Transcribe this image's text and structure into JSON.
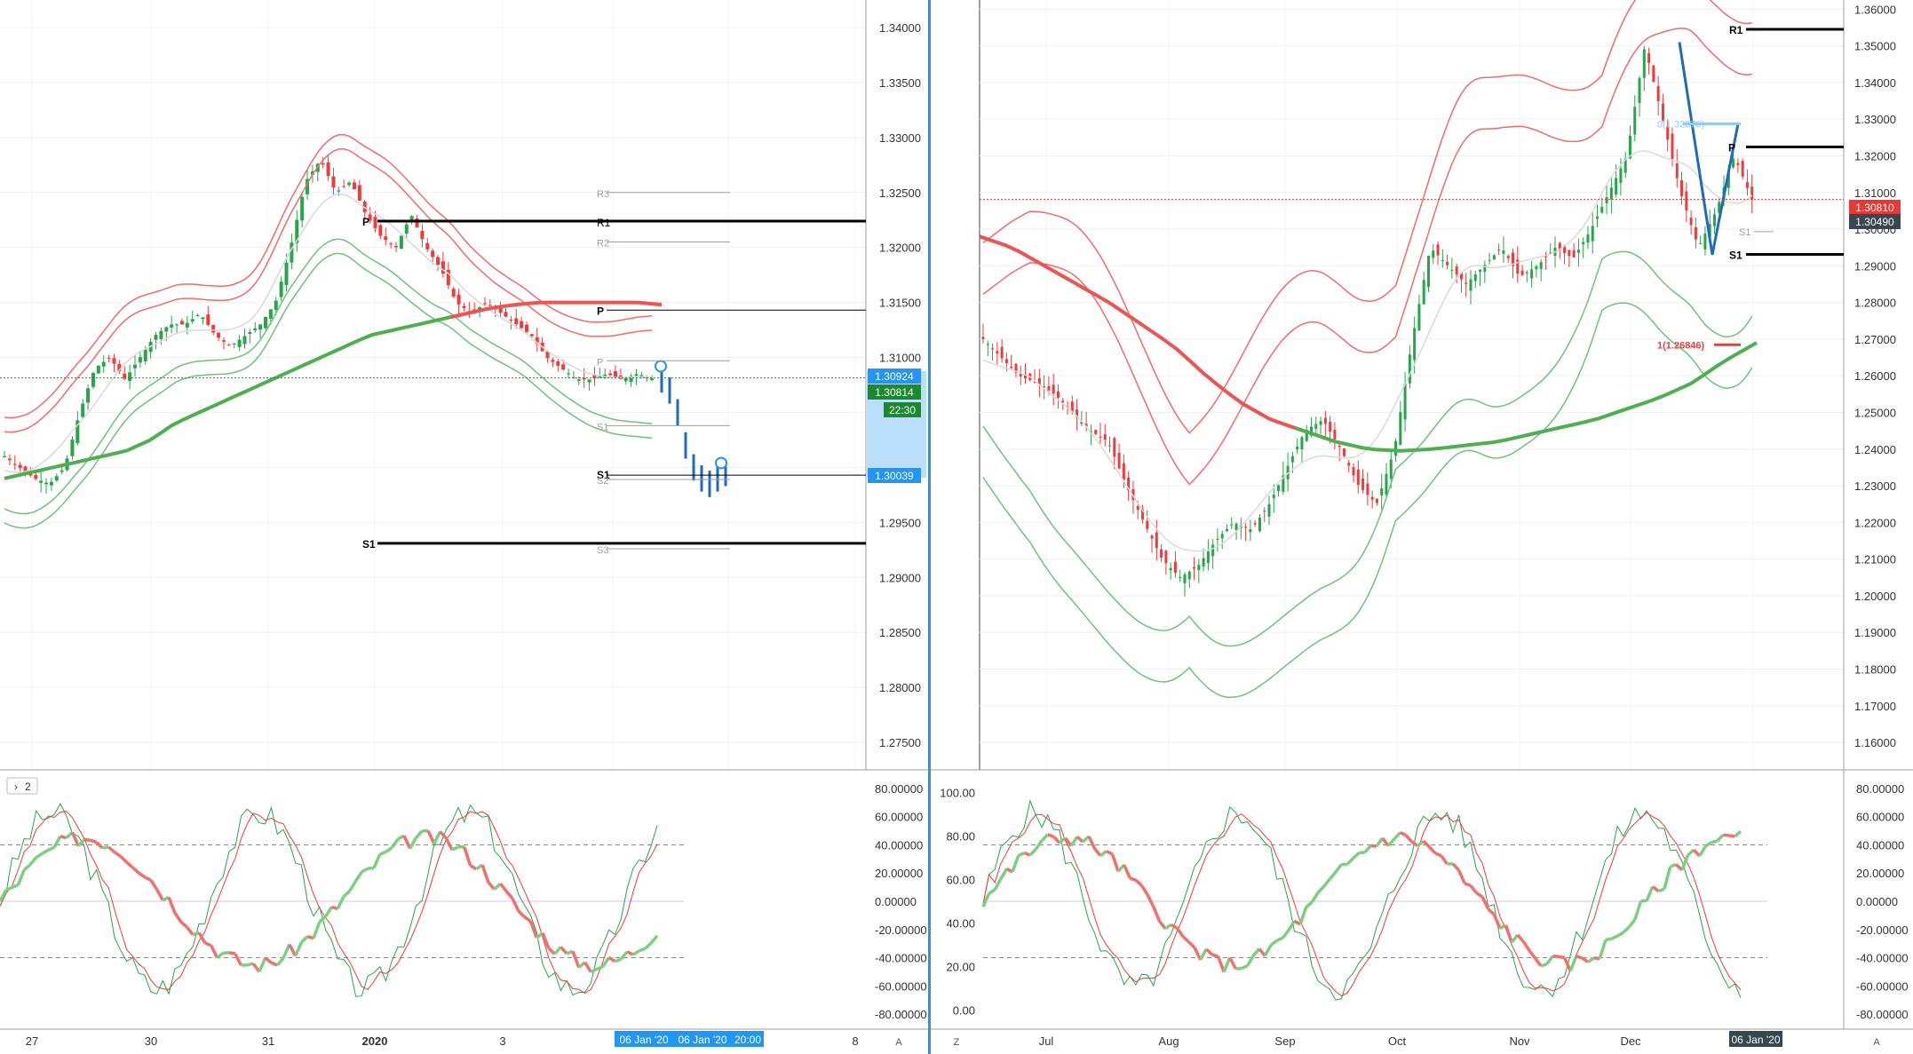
{
  "colors": {
    "up": "#26a64a",
    "down": "#ef3b3b",
    "bb_upper": "#f26b6b",
    "bb_lower": "#6fc27a",
    "ma_mid": "#d9d9d9",
    "ma_long_green": "#4caf50",
    "ma_long_red": "#ef5350",
    "pivot": "#000000",
    "pivot_minor": "#9e9e9e",
    "projection": "#1e6bb8",
    "price_tag_green": "#1b8a2e",
    "price_tag_red": "#e53935",
    "price_tag_dark": "#37474f",
    "blue_tag": "#2196f3",
    "light_blue": "#bbdefb",
    "grid": "#eeeeee"
  },
  "left_panel": {
    "price_axis": [
      "1.34000",
      "1.33500",
      "1.33000",
      "1.32500",
      "1.32000",
      "1.31500",
      "1.31000",
      "1.30500",
      "1.30000",
      "1.29500",
      "1.29000",
      "1.28500",
      "1.28000",
      "1.27500"
    ],
    "price_tags": {
      "upper_blue": "1.30924",
      "current_green": "1.30814",
      "countdown": "22:30",
      "lower_blue": "1.30039"
    },
    "pivot_labels": {
      "p_major": "P",
      "r1": "R1",
      "p_mid": "P",
      "s1_mid": "S1",
      "s1_major": "S1",
      "s1_small": "S1",
      "s2_small": "S2",
      "s3": "S3",
      "r2": "R2",
      "r3": "R3",
      "p_small": "P"
    },
    "date_axis": [
      "27",
      "30",
      "31",
      "2020",
      "3",
      "8"
    ],
    "date_tags": [
      "06 Jan '20",
      "06 Jan '20",
      "20:00"
    ],
    "axis_corner": "A",
    "indicator_badge": "2",
    "oscillator_axis": [
      "80.00000",
      "60.00000",
      "40.00000",
      "20.00000",
      "0.00000",
      "-20.00000",
      "-40.00000",
      "-60.00000",
      "-80.00000"
    ]
  },
  "right_panel": {
    "price_axis": [
      "1.36000",
      "1.35000",
      "1.34000",
      "1.33000",
      "1.32000",
      "1.31000",
      "1.30000",
      "1.29000",
      "1.28000",
      "1.27000",
      "1.26000",
      "1.25000",
      "1.24000",
      "1.23000",
      "1.22000",
      "1.21000",
      "1.20000",
      "1.19000",
      "1.18000",
      "1.17000",
      "1.16000"
    ],
    "price_tags": {
      "red": "1.30810",
      "dark": "1.30490"
    },
    "pivot_labels": {
      "r1": "R1",
      "p": "P",
      "s1": "S1",
      "s1_minor": "S1"
    },
    "fib_labels": {
      "top": "0(1.32870)",
      "bottom": "1(1.26846)"
    },
    "date_axis": [
      "Jul",
      "Aug",
      "Sep",
      "Oct",
      "Nov",
      "Dec"
    ],
    "date_tag": "06 Jan '20",
    "axis_left_corner": "Z",
    "axis_corner": "A",
    "oscillator_left_axis": [
      "100.00",
      "80.00",
      "60.00",
      "40.00",
      "20.00",
      "0.00"
    ],
    "oscillator_axis": [
      "80.00000",
      "60.00000",
      "40.00000",
      "20.00000",
      "0.00000",
      "-20.00000",
      "-40.00000",
      "-60.00000",
      "-80.00000"
    ]
  },
  "chart_data": [
    {
      "type": "line",
      "title": "",
      "ylim": [
        1.2725,
        1.3425
      ],
      "x": [
        "27",
        "30",
        "31",
        "2020",
        "3",
        "8"
      ],
      "series": [
        {
          "values": [
            1.301,
            1.3,
            1.299,
            1.2985,
            1.3,
            1.305,
            1.309,
            1.31,
            1.308,
            1.31,
            1.312,
            1.313,
            1.313,
            1.314,
            1.312,
            1.311,
            1.312,
            1.313,
            1.315,
            1.32,
            1.326,
            1.328,
            1.325,
            1.326,
            1.323,
            1.321,
            1.32,
            1.323,
            1.32,
            1.318,
            1.315,
            1.314,
            1.315,
            1.314,
            1.313,
            1.312,
            1.31,
            1.309,
            1.308,
            1.308,
            1.3085,
            1.308,
            1.3085,
            1.3081
          ]
        },
        {
          "values": [
            1.299,
            1.2995,
            1.3,
            1.3005,
            1.301,
            1.3015,
            1.3025,
            1.304,
            1.305,
            1.306,
            1.307,
            1.308,
            1.309,
            1.31,
            1.311,
            1.312,
            1.3125,
            1.313,
            1.3135,
            1.314,
            1.3145,
            1.3148,
            1.315,
            1.315,
            1.315,
            1.315,
            1.315,
            1.3148
          ]
        },
        {
          "values": [
            1.308,
            1.307,
            1.305,
            1.302,
            1.3,
            1.299,
            1.2985,
            1.299,
            1.2995
          ]
        }
      ]
    },
    {
      "type": "line",
      "title": "",
      "ylim": [
        1.155,
        1.365
      ],
      "x": [
        "Jul",
        "Aug",
        "Sep",
        "Oct",
        "Nov",
        "Dec"
      ],
      "series": [
        {
          "values": [
            1.27,
            1.265,
            1.26,
            1.258,
            1.255,
            1.25,
            1.245,
            1.242,
            1.23,
            1.22,
            1.21,
            1.205,
            1.208,
            1.215,
            1.22,
            1.218,
            1.225,
            1.235,
            1.245,
            1.248,
            1.24,
            1.23,
            1.225,
            1.24,
            1.27,
            1.295,
            1.29,
            1.285,
            1.29,
            1.295,
            1.287,
            1.29,
            1.295,
            1.292,
            1.3,
            1.31,
            1.32,
            1.35,
            1.33,
            1.31,
            1.295,
            1.305,
            1.32,
            1.3081
          ]
        },
        {
          "values": [
            1.298,
            1.295,
            1.29,
            1.285,
            1.28,
            1.274,
            1.268,
            1.26,
            1.253,
            1.248,
            1.245,
            1.242,
            1.24,
            1.2395,
            1.24,
            1.241,
            1.242,
            1.244,
            1.246,
            1.248,
            1.251,
            1.254,
            1.258,
            1.264,
            1.269
          ]
        }
      ]
    }
  ]
}
